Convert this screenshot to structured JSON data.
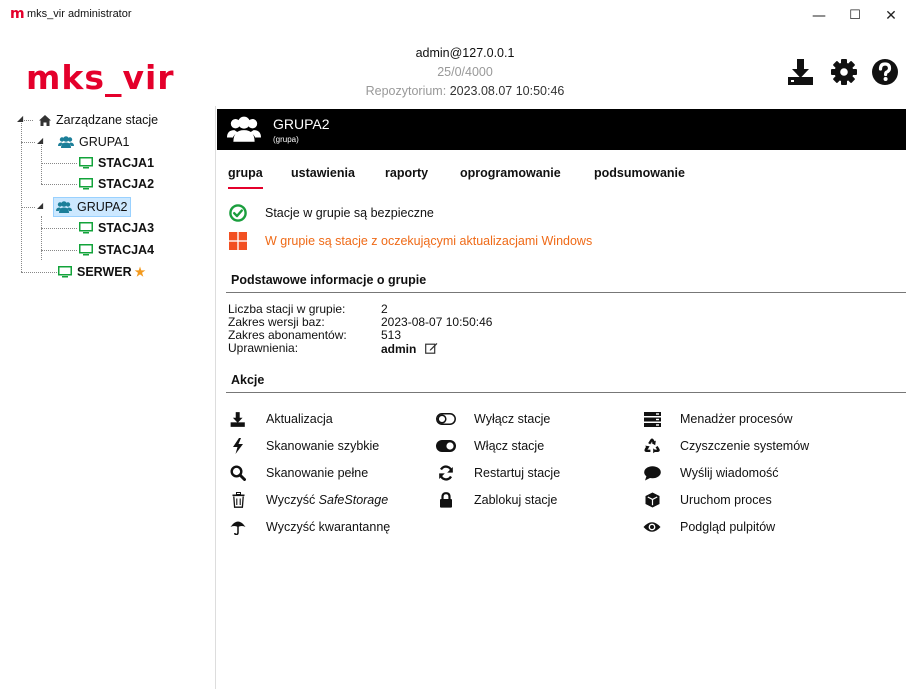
{
  "window": {
    "icon_letter": "m",
    "title": "mks_vir administrator",
    "minimize": "—",
    "maximize": "☐",
    "close": "✕"
  },
  "header": {
    "logo": "mks_vir",
    "user": "admin@127.0.0.1",
    "counts": "25/0/4000",
    "repo_label": "Repozytorium:",
    "repo_date": "2023.08.07 10:50:46",
    "icons": [
      "download-icon",
      "gear-icon",
      "help-icon"
    ]
  },
  "tree": {
    "root": "Zarządzane stacje",
    "groups": [
      {
        "name": "GRUPA1",
        "stations": [
          "STACJA1",
          "STACJA2"
        ]
      },
      {
        "name": "GRUPA2",
        "stations": [
          "STACJA3",
          "STACJA4"
        ]
      }
    ],
    "server": "SERWER"
  },
  "group": {
    "name": "GRUPA2",
    "subtitle": "(grupa)"
  },
  "tabs": [
    "grupa",
    "ustawienia",
    "raporty",
    "oprogramowanie",
    "podsumowanie"
  ],
  "active_tab": "grupa",
  "status": {
    "ok": "Stacje w grupie są bezpieczne",
    "warning": "W grupie są stacje z oczekującymi aktualizacjami Windows",
    "warning_color": "#ef6a17"
  },
  "info": {
    "title": "Podstawowe informacje o grupie",
    "rows": [
      {
        "label": "Liczba stacji w grupie:",
        "value": "2"
      },
      {
        "label": "Zakres wersji baz:",
        "value": "2023-08-07 10:50:46"
      },
      {
        "label": "Zakres abonamentów:",
        "value": "513"
      },
      {
        "label": "Uprawnienia:",
        "value": "admin"
      }
    ]
  },
  "actions": {
    "title": "Akcje",
    "col1": [
      {
        "label": "Aktualizacja",
        "icon": "download-icon"
      },
      {
        "label": "Skanowanie szybkie",
        "icon": "bolt-icon"
      },
      {
        "label": "Skanowanie pełne",
        "icon": "search-icon"
      },
      {
        "label": "Wyczyść ",
        "label_italic": "SafeStorage",
        "icon": "trash-icon"
      },
      {
        "label": "Wyczyść kwarantannę",
        "icon": "umbrella-icon"
      }
    ],
    "col2": [
      {
        "label": "Wyłącz stacje",
        "icon": "toggle-off-icon"
      },
      {
        "label": "Włącz stacje",
        "icon": "toggle-on-icon"
      },
      {
        "label": "Restartuj stacje",
        "icon": "refresh-icon"
      },
      {
        "label": "Zablokuj stacje",
        "icon": "lock-icon"
      }
    ],
    "col3": [
      {
        "label": "Menadżer procesów",
        "icon": "server-icon"
      },
      {
        "label": "Czyszczenie systemów",
        "icon": "recycle-icon"
      },
      {
        "label": "Wyślij wiadomość",
        "icon": "chat-icon"
      },
      {
        "label": "Uruchom proces",
        "icon": "cube-icon"
      },
      {
        "label": "Podgląd pulpitów",
        "icon": "eye-icon"
      }
    ]
  },
  "colors": {
    "brand_red": "#e4002b",
    "station_green": "#12a33a",
    "group_teal": "#1c7f99",
    "ok_green": "#1a9e3d",
    "windows_orange": "#f25022"
  }
}
